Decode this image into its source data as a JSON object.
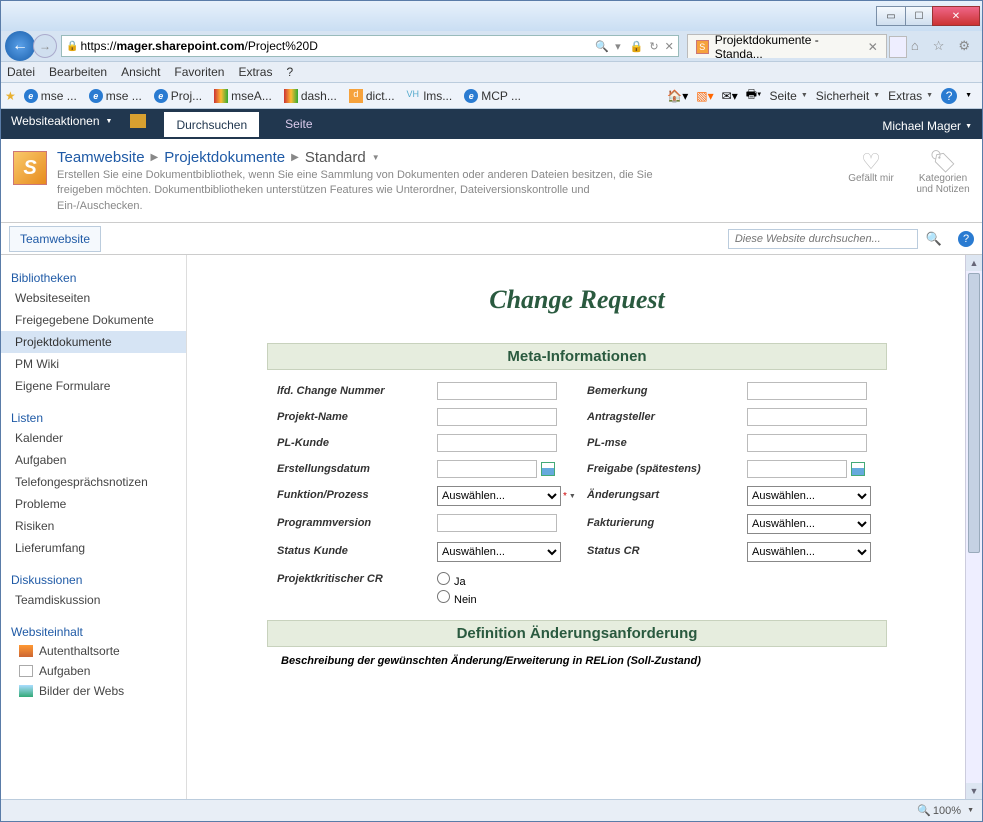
{
  "browser": {
    "url_prefix": "https://",
    "url_domain": "mager.sharepoint.com",
    "url_path": "/Project%20D",
    "url_suffix_icons": [
      "🔒",
      "↻",
      "✕"
    ],
    "tab_title": "Projektdokumente - Standa...",
    "menus": [
      "Datei",
      "Bearbeiten",
      "Ansicht",
      "Favoriten",
      "Extras",
      "?"
    ],
    "favorites": [
      "mse ...",
      "mse ...",
      "Proj...",
      "mseA...",
      "dash...",
      "dict...",
      "lms...",
      "MCP ..."
    ],
    "fav_right": [
      "Seite",
      "Sicherheit",
      "Extras"
    ],
    "zoom": "100%"
  },
  "ribbon": {
    "site_actions": "Websiteaktionen",
    "tab_browse": "Durchsuchen",
    "tab_page": "Seite",
    "user": "Michael Mager"
  },
  "header": {
    "crumb1": "Teamwebsite",
    "crumb2": "Projektdokumente",
    "crumb3": "Standard",
    "desc": "Erstellen Sie eine Dokumentbibliothek, wenn Sie eine Sammlung von Dokumenten oder anderen Dateien besitzen, die Sie freigeben möchten. Dokumentbibliotheken unterstützen Features wie Unterordner, Dateiversionskontrolle und Ein-/Auschecken.",
    "like": "Gefällt mir",
    "tags": "Kategorien und Notizen"
  },
  "subbar": {
    "site_tab": "Teamwebsite",
    "search_placeholder": "Diese Website durchsuchen..."
  },
  "nav": {
    "bibliotheken": "Bibliotheken",
    "lib_items": [
      "Websiteseiten",
      "Freigegebene Dokumente",
      "Projektdokumente",
      "PM Wiki",
      "Eigene Formulare"
    ],
    "listen": "Listen",
    "list_items": [
      "Kalender",
      "Aufgaben",
      "Telefongesprächsnotizen",
      "Probleme",
      "Risiken",
      "Lieferumfang"
    ],
    "diskussionen": "Diskussionen",
    "disc_items": [
      "Teamdiskussion"
    ],
    "websiteinhalt": "Websiteinhalt",
    "wc_items": [
      "Autenthaltsorte",
      "Aufgaben",
      "Bilder der Webs"
    ]
  },
  "form": {
    "title": "Change Request",
    "section1": "Meta-Informationen",
    "labels": {
      "lfd": "lfd. Change Nummer",
      "bemerkung": "Bemerkung",
      "projekt": "Projekt-Name",
      "antragsteller": "Antragsteller",
      "plkunde": "PL-Kunde",
      "plmse": "PL-mse",
      "erstellung": "Erstellungsdatum",
      "freigabe": "Freigabe (spätestens)",
      "funktion": "Funktion/Prozess",
      "aenderungsart": "Änderungsart",
      "progver": "Programmversion",
      "fakturierung": "Fakturierung",
      "statuskunde": "Status Kunde",
      "statuscr": "Status CR",
      "projkrit": "Projektkritischer CR",
      "ja": "Ja",
      "nein": "Nein"
    },
    "select_default": "Auswählen...",
    "section2": "Definition Änderungsanforderung",
    "desc2": "Beschreibung der gewünschten Änderung/Erweiterung in RELion (Soll-Zustand)"
  }
}
